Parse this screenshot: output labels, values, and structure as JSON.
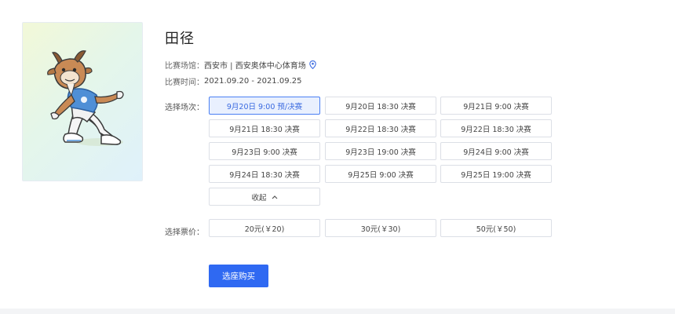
{
  "event": {
    "title": "田径",
    "venue_label": "比赛场馆：",
    "venue_value": "西安市 | 西安奥体中心体育场",
    "venue_icon": "location-pin-icon",
    "time_label": "比赛时间：",
    "time_value": "2021.09.20 - 2021.09.25",
    "poster": "mascot-running-illustration"
  },
  "sessions": {
    "label": "选择场次：",
    "selected_index": 0,
    "items": [
      "9月20日 9:00 预/决赛",
      "9月20日 18:30 决赛",
      "9月21日 9:00 决赛",
      "9月21日 18:30 决赛",
      "9月22日 18:30 决赛",
      "9月22日 18:30 决赛",
      "9月23日 9:00 决赛",
      "9月23日 19:00 决赛",
      "9月24日 9:00 决赛",
      "9月24日 18:30 决赛",
      "9月25日 9:00 决赛",
      "9月25日 19:00 决赛"
    ],
    "collapse_label": "收起",
    "collapse_icon": "chevron-up-icon"
  },
  "prices": {
    "label": "选择票价：",
    "items": [
      "20元(￥20)",
      "30元(￥30)",
      "50元(￥50)"
    ]
  },
  "actions": {
    "buy_label": "选座购买"
  },
  "colors": {
    "accent": "#2f69f2",
    "selected_bg": "#e9f0fe",
    "selected_border": "#4a7ff3",
    "border": "#dcdfe6"
  }
}
